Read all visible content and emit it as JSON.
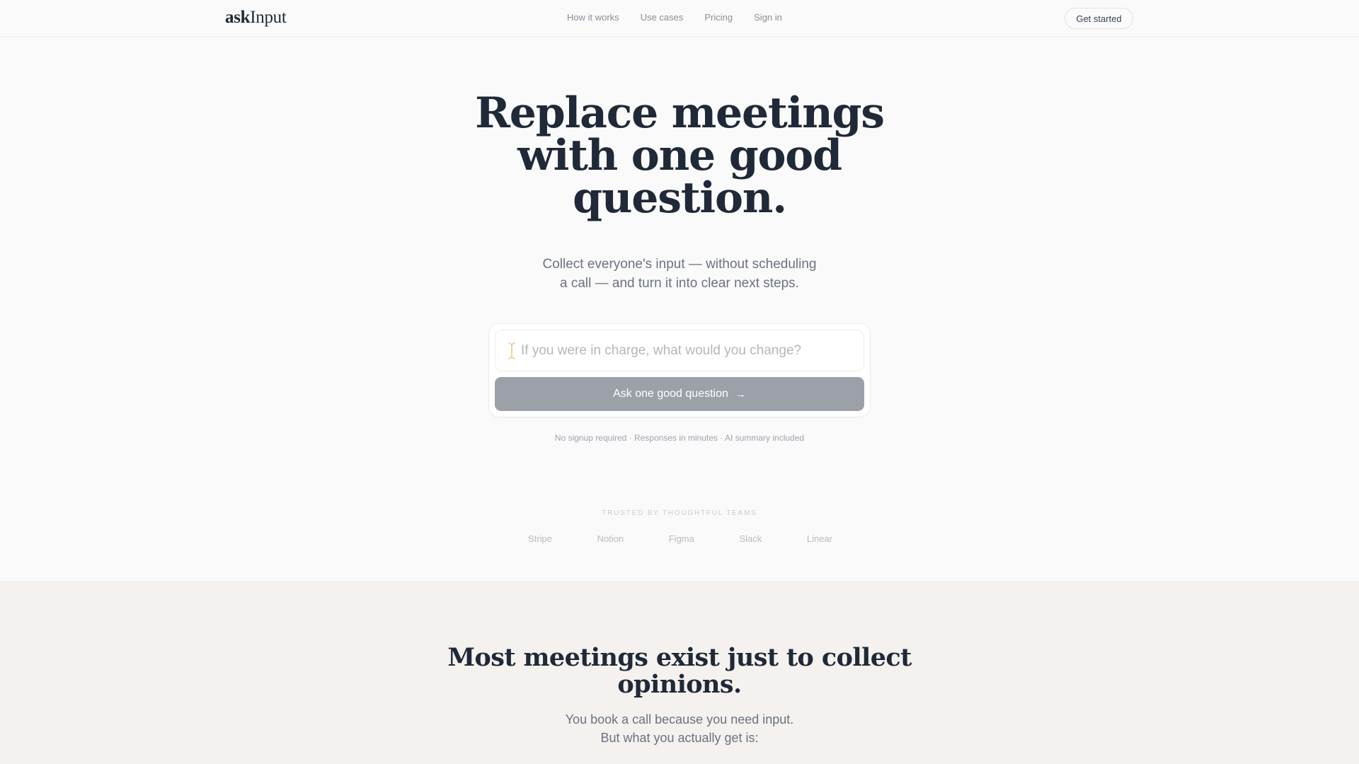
{
  "nav": {
    "logo_bold": "ask",
    "logo_light": "Input",
    "links": [
      "How it works",
      "Use cases",
      "Pricing",
      "Sign in"
    ],
    "cta": "Get started"
  },
  "hero": {
    "title": "Replace meetings with one good question.",
    "subtitle_line1": "Collect everyone's input — without scheduling",
    "subtitle_line2": "a call — and turn it into clear next steps.",
    "input_placeholder": "If you were in charge, what would you change?",
    "button_label": "Ask one good question",
    "button_icon": "arrow-right-icon",
    "fineprint": "No signup required · Responses in minutes · AI summary included"
  },
  "trusted": {
    "label": "TRUSTED BY THOUGHTFUL TEAMS",
    "brands": [
      "Stripe",
      "Notion",
      "Figma",
      "Slack",
      "Linear"
    ]
  },
  "section2": {
    "title": "Most meetings exist just to collect opinions.",
    "subtitle_line1": "You book a call because you need input.",
    "subtitle_line2": "But what you actually get is:"
  },
  "colors": {
    "background": "#fafafa",
    "section2_background": "#f4f1ee",
    "heading": "#1f2937",
    "button_disabled": "#9ca0a8",
    "caret_accent": "#e9c98a"
  }
}
